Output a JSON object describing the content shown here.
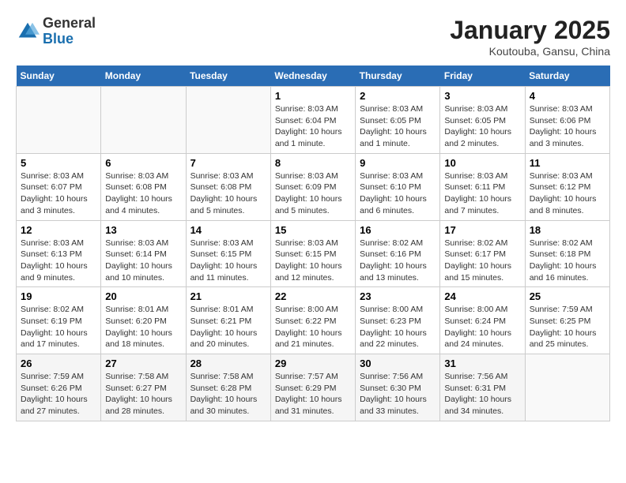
{
  "header": {
    "logo_general": "General",
    "logo_blue": "Blue",
    "month_title": "January 2025",
    "location": "Koutouba, Gansu, China"
  },
  "weekdays": [
    "Sunday",
    "Monday",
    "Tuesday",
    "Wednesday",
    "Thursday",
    "Friday",
    "Saturday"
  ],
  "weeks": [
    [
      {
        "day": "",
        "info": ""
      },
      {
        "day": "",
        "info": ""
      },
      {
        "day": "",
        "info": ""
      },
      {
        "day": "1",
        "info": "Sunrise: 8:03 AM\nSunset: 6:04 PM\nDaylight: 10 hours\nand 1 minute."
      },
      {
        "day": "2",
        "info": "Sunrise: 8:03 AM\nSunset: 6:05 PM\nDaylight: 10 hours\nand 1 minute."
      },
      {
        "day": "3",
        "info": "Sunrise: 8:03 AM\nSunset: 6:05 PM\nDaylight: 10 hours\nand 2 minutes."
      },
      {
        "day": "4",
        "info": "Sunrise: 8:03 AM\nSunset: 6:06 PM\nDaylight: 10 hours\nand 3 minutes."
      }
    ],
    [
      {
        "day": "5",
        "info": "Sunrise: 8:03 AM\nSunset: 6:07 PM\nDaylight: 10 hours\nand 3 minutes."
      },
      {
        "day": "6",
        "info": "Sunrise: 8:03 AM\nSunset: 6:08 PM\nDaylight: 10 hours\nand 4 minutes."
      },
      {
        "day": "7",
        "info": "Sunrise: 8:03 AM\nSunset: 6:08 PM\nDaylight: 10 hours\nand 5 minutes."
      },
      {
        "day": "8",
        "info": "Sunrise: 8:03 AM\nSunset: 6:09 PM\nDaylight: 10 hours\nand 5 minutes."
      },
      {
        "day": "9",
        "info": "Sunrise: 8:03 AM\nSunset: 6:10 PM\nDaylight: 10 hours\nand 6 minutes."
      },
      {
        "day": "10",
        "info": "Sunrise: 8:03 AM\nSunset: 6:11 PM\nDaylight: 10 hours\nand 7 minutes."
      },
      {
        "day": "11",
        "info": "Sunrise: 8:03 AM\nSunset: 6:12 PM\nDaylight: 10 hours\nand 8 minutes."
      }
    ],
    [
      {
        "day": "12",
        "info": "Sunrise: 8:03 AM\nSunset: 6:13 PM\nDaylight: 10 hours\nand 9 minutes."
      },
      {
        "day": "13",
        "info": "Sunrise: 8:03 AM\nSunset: 6:14 PM\nDaylight: 10 hours\nand 10 minutes."
      },
      {
        "day": "14",
        "info": "Sunrise: 8:03 AM\nSunset: 6:15 PM\nDaylight: 10 hours\nand 11 minutes."
      },
      {
        "day": "15",
        "info": "Sunrise: 8:03 AM\nSunset: 6:15 PM\nDaylight: 10 hours\nand 12 minutes."
      },
      {
        "day": "16",
        "info": "Sunrise: 8:02 AM\nSunset: 6:16 PM\nDaylight: 10 hours\nand 13 minutes."
      },
      {
        "day": "17",
        "info": "Sunrise: 8:02 AM\nSunset: 6:17 PM\nDaylight: 10 hours\nand 15 minutes."
      },
      {
        "day": "18",
        "info": "Sunrise: 8:02 AM\nSunset: 6:18 PM\nDaylight: 10 hours\nand 16 minutes."
      }
    ],
    [
      {
        "day": "19",
        "info": "Sunrise: 8:02 AM\nSunset: 6:19 PM\nDaylight: 10 hours\nand 17 minutes."
      },
      {
        "day": "20",
        "info": "Sunrise: 8:01 AM\nSunset: 6:20 PM\nDaylight: 10 hours\nand 18 minutes."
      },
      {
        "day": "21",
        "info": "Sunrise: 8:01 AM\nSunset: 6:21 PM\nDaylight: 10 hours\nand 20 minutes."
      },
      {
        "day": "22",
        "info": "Sunrise: 8:00 AM\nSunset: 6:22 PM\nDaylight: 10 hours\nand 21 minutes."
      },
      {
        "day": "23",
        "info": "Sunrise: 8:00 AM\nSunset: 6:23 PM\nDaylight: 10 hours\nand 22 minutes."
      },
      {
        "day": "24",
        "info": "Sunrise: 8:00 AM\nSunset: 6:24 PM\nDaylight: 10 hours\nand 24 minutes."
      },
      {
        "day": "25",
        "info": "Sunrise: 7:59 AM\nSunset: 6:25 PM\nDaylight: 10 hours\nand 25 minutes."
      }
    ],
    [
      {
        "day": "26",
        "info": "Sunrise: 7:59 AM\nSunset: 6:26 PM\nDaylight: 10 hours\nand 27 minutes."
      },
      {
        "day": "27",
        "info": "Sunrise: 7:58 AM\nSunset: 6:27 PM\nDaylight: 10 hours\nand 28 minutes."
      },
      {
        "day": "28",
        "info": "Sunrise: 7:58 AM\nSunset: 6:28 PM\nDaylight: 10 hours\nand 30 minutes."
      },
      {
        "day": "29",
        "info": "Sunrise: 7:57 AM\nSunset: 6:29 PM\nDaylight: 10 hours\nand 31 minutes."
      },
      {
        "day": "30",
        "info": "Sunrise: 7:56 AM\nSunset: 6:30 PM\nDaylight: 10 hours\nand 33 minutes."
      },
      {
        "day": "31",
        "info": "Sunrise: 7:56 AM\nSunset: 6:31 PM\nDaylight: 10 hours\nand 34 minutes."
      },
      {
        "day": "",
        "info": ""
      }
    ]
  ]
}
